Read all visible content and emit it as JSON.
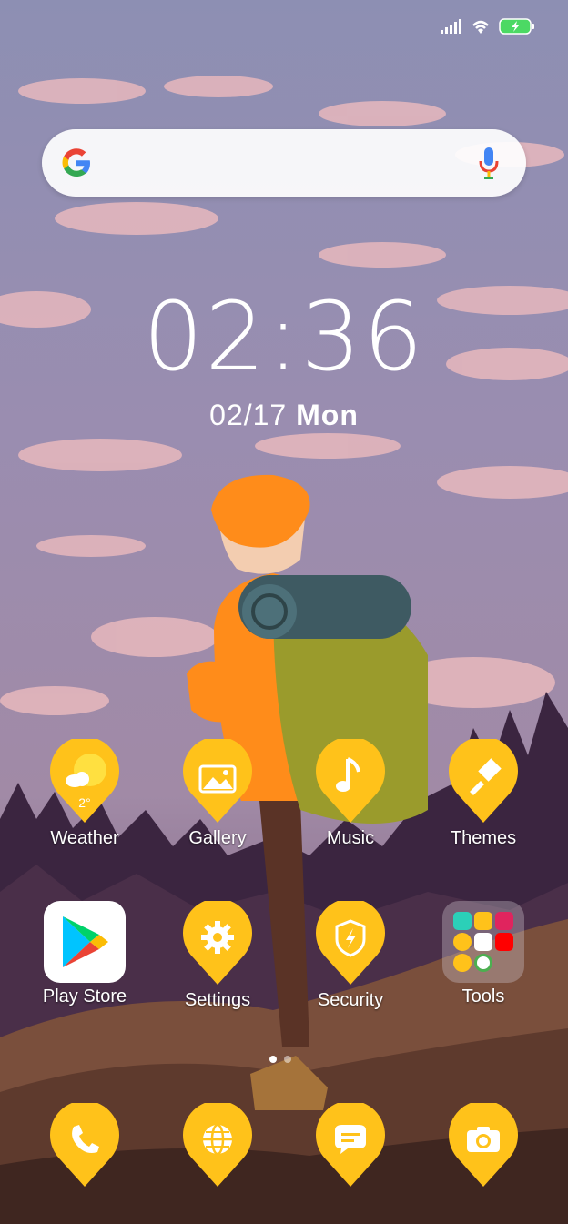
{
  "clock": {
    "time": "02:36",
    "date": "02/17",
    "weekday": "Mon"
  },
  "weather": {
    "temp": "2°"
  },
  "apps_row1": [
    {
      "label": "Weather",
      "icon": "weather-icon"
    },
    {
      "label": "Gallery",
      "icon": "gallery-icon"
    },
    {
      "label": "Music",
      "icon": "music-note-icon"
    },
    {
      "label": "Themes",
      "icon": "paintbrush-icon"
    }
  ],
  "apps_row2": [
    {
      "label": "Play Store",
      "icon": "play-store-icon"
    },
    {
      "label": "Settings",
      "icon": "gear-icon"
    },
    {
      "label": "Security",
      "icon": "shield-bolt-icon"
    },
    {
      "label": "Tools",
      "icon": "folder-icon"
    }
  ],
  "dock": [
    {
      "name": "phone",
      "icon": "phone-icon"
    },
    {
      "name": "browser",
      "icon": "globe-icon"
    },
    {
      "name": "messages",
      "icon": "chat-icon"
    },
    {
      "name": "camera",
      "icon": "camera-icon"
    }
  ],
  "colors": {
    "accent": "#FFC21A",
    "accent_dark": "#F5A800"
  }
}
